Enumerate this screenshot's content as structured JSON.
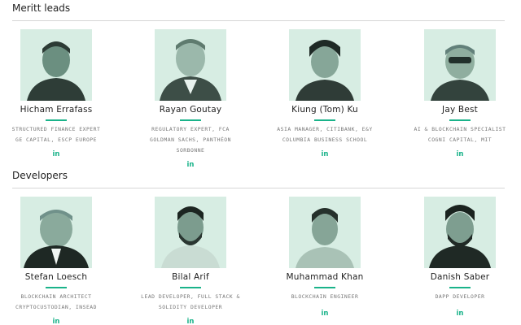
{
  "sections": [
    {
      "title": "Meritt leads",
      "members": [
        {
          "name": "Hicham Errafass",
          "line1": "STRUCTURED FINANCE EXPERT",
          "line2": "GE CAPITAL, ESCP EUROPE",
          "link": "in",
          "photo": "portrait-icon"
        },
        {
          "name": "Rayan Goutay",
          "line1": "REGULATORY EXPERT, FCA",
          "line2": "GOLDMAN SACHS, PANTHÉON SORBONNE",
          "link": "in",
          "photo": "portrait-icon"
        },
        {
          "name": "Kiung (Tom) Ku",
          "line1": "ASIA MANAGER, CITIBANK, E&Y",
          "line2": "COLUMBIA BUSINESS SCHOOL",
          "link": "in",
          "photo": "portrait-icon"
        },
        {
          "name": "Jay Best",
          "line1": "AI & BLOCKCHAIN SPECIALIST",
          "line2": "COGNI CAPITAL, MIT",
          "link": "in",
          "photo": "portrait-icon"
        }
      ]
    },
    {
      "title": "Developers",
      "members": [
        {
          "name": "Stefan Loesch",
          "line1": "BLOCKCHAIN ARCHITECT",
          "line2": "CRYPTOCUSTODIAN, INSEAD",
          "link": "in",
          "photo": "portrait-icon"
        },
        {
          "name": "Bilal Arif",
          "line1": "LEAD DEVELOPER, FULL STACK & SOLIDITY DEVELOPER",
          "line2": "",
          "link": "in",
          "photo": "portrait-icon"
        },
        {
          "name": "Muhammad Khan",
          "line1": "BLOCKCHAIN ENGINEER",
          "line2": "",
          "link": "in",
          "photo": "portrait-icon"
        },
        {
          "name": "Danish Saber",
          "line1": "DAPP DEVELOPER",
          "line2": "",
          "link": "in",
          "photo": "portrait-icon"
        }
      ]
    }
  ],
  "colors": {
    "accent": "#1ab38a",
    "photo_bg": "#d7ede3"
  }
}
